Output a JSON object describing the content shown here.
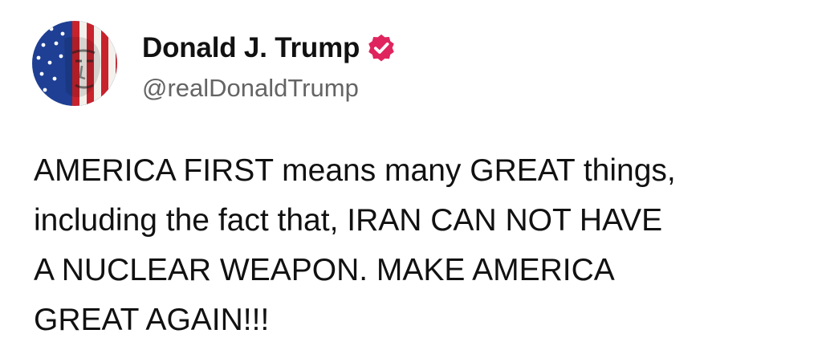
{
  "author": {
    "display_name": "Donald J. Trump",
    "handle": "@realDonaldTrump",
    "verified": true,
    "avatar_icon": "flag-portrait-avatar",
    "verified_icon": "verified-badge-icon",
    "verified_color": "#e0245e"
  },
  "post": {
    "lines": [
      "AMERICA FIRST means many GREAT things,",
      "including the fact that, IRAN CAN NOT HAVE",
      "A NUCLEAR WEAPON. MAKE AMERICA",
      "GREAT AGAIN!!!"
    ]
  }
}
